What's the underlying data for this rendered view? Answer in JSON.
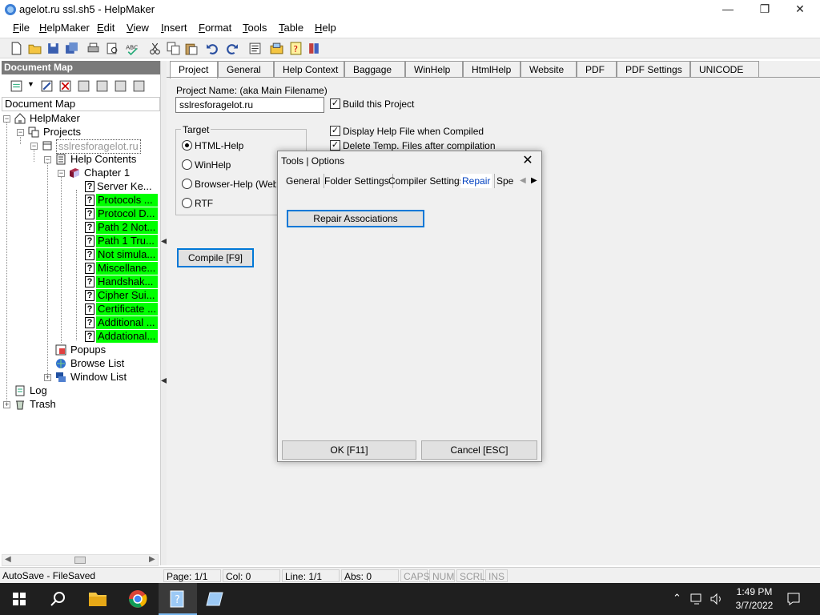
{
  "window": {
    "title": "agelot.ru ssl.sh5 - HelpMaker",
    "min_glyph": "—",
    "max_glyph": "❐",
    "close_glyph": "✕"
  },
  "menu": [
    "File",
    "HelpMaker",
    "Edit",
    "View",
    "Insert",
    "Format",
    "Tools",
    "Table",
    "Help"
  ],
  "toolbar_icons": [
    "new-icon",
    "open-icon",
    "save-icon",
    "save-all-icon",
    "print-icon",
    "print-preview-icon",
    "spellcheck-icon",
    "cut-icon",
    "copy-icon",
    "paste-icon",
    "undo-icon",
    "redo-icon",
    "properties-icon",
    "topic-icon",
    "help-icon",
    "compile-icon"
  ],
  "left_panel": {
    "header": "Document Map",
    "label": "Document Map",
    "tree": {
      "root": "HelpMaker",
      "projects": "Projects",
      "project_name": "sslresforagelot.ru",
      "help_contents": "Help Contents",
      "chapter": "Chapter 1",
      "topics": [
        {
          "label": "Server Ke...",
          "highlight": false
        },
        {
          "label": "Protocols ...",
          "highlight": true
        },
        {
          "label": "Protocol D...",
          "highlight": true
        },
        {
          "label": "Path 2 Not...",
          "highlight": true
        },
        {
          "label": "Path 1 Tru...",
          "highlight": true
        },
        {
          "label": "Not simula...",
          "highlight": true
        },
        {
          "label": "Miscellane...",
          "highlight": true
        },
        {
          "label": "Handshak...",
          "highlight": true
        },
        {
          "label": "Cipher Sui...",
          "highlight": true
        },
        {
          "label": "Certificate ...",
          "highlight": true
        },
        {
          "label": "Additional ...",
          "highlight": true
        },
        {
          "label": "Addational...",
          "highlight": true
        }
      ],
      "popups": "Popups",
      "browse_list": "Browse List",
      "window_list": "Window List",
      "log": "Log",
      "trash": "Trash"
    }
  },
  "tabs": [
    "Project",
    "General",
    "Help Context",
    "Baggage",
    "WinHelp",
    "HtmlHelp",
    "Website",
    "PDF",
    "PDF Settings",
    "UNICODE"
  ],
  "active_tab": "Project",
  "project": {
    "name_label": "Project Name: (aka Main Filename)",
    "name_value": "sslresforagelot.ru",
    "build_label": "Build this Project",
    "build_checked": true,
    "display_label": "Display Help File when Compiled",
    "display_checked": true,
    "delete_label": "Delete Temp. Files after compilation",
    "delete_checked": true,
    "target_label": "Target",
    "targets": [
      {
        "label": "HTML-Help",
        "selected": true
      },
      {
        "label": "WinHelp",
        "selected": false
      },
      {
        "label": "Browser-Help (Website)",
        "selected": false
      },
      {
        "label": "RTF",
        "selected": false
      }
    ],
    "compile_button": "Compile [F9]"
  },
  "dialog": {
    "title": "Tools | Options",
    "tabs": [
      "General",
      "Folder Settings",
      "Compiler Settings",
      "Repair",
      "Spel"
    ],
    "active_tab": "Repair",
    "repair_button": "Repair Associations",
    "ok_button": "OK [F11]",
    "cancel_button": "Cancel [ESC]"
  },
  "statusbar": {
    "autosave": "AutoSave - FileSaved",
    "page": "Page: 1/1",
    "col": "Col: 0",
    "line": "Line: 1/1",
    "abs": "Abs: 0",
    "caps": "CAPS",
    "num": "NUM",
    "scrl": "SCRL",
    "ins": "INS"
  },
  "taskbar": {
    "time": "1:49 PM",
    "date": "3/7/2022",
    "pinned": [
      "file-explorer-icon",
      "chrome-icon",
      "helpmaker-icon",
      "notepad-icon"
    ]
  },
  "colors": {
    "highlight": "#00ff00",
    "focus": "#0078d7",
    "taskbar": "#1f1f1f"
  }
}
